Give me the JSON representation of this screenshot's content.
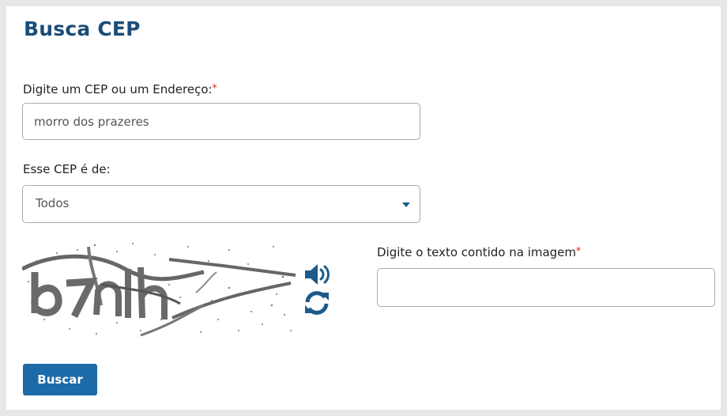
{
  "page": {
    "title": "Busca CEP"
  },
  "form": {
    "cep_label": "Digite um CEP ou um Endereço:",
    "required_mark": "*",
    "cep_value": "morro dos prazeres",
    "tipo_label": "Esse CEP é de:",
    "tipo_selected": "Todos",
    "captcha_label": "Digite o texto contido na imagem",
    "captcha_value": "",
    "submit_label": "Buscar"
  },
  "icons": {
    "audio": "speaker-icon",
    "refresh": "refresh-icon",
    "dropdown": "caret-down-icon"
  },
  "colors": {
    "title": "#1b4d77",
    "button": "#1c6aa8",
    "required": "#dd2222",
    "icon": "#1b5a8a"
  }
}
